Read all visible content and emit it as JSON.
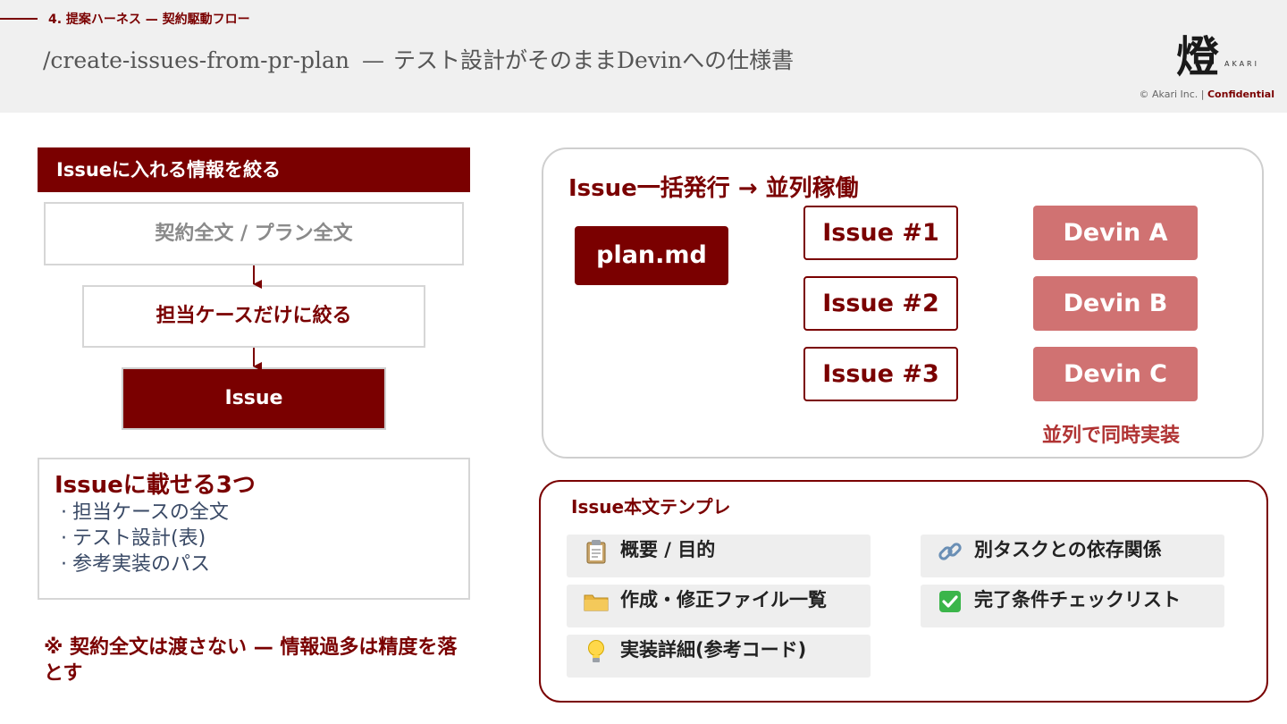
{
  "header": {
    "section_label": "4. 提案ハーネス — 契約駆動フロー",
    "title_command": "/create-issues-from-pr-plan",
    "title_separator": "—",
    "title_text": "テスト設計がそのままDevinへの仕様書",
    "logo_glyph": "燈",
    "logo_subtext": "AKARI",
    "copyright_prefix": "© Akari Inc. | ",
    "copyright_emphasis": "Confidential"
  },
  "left": {
    "section_header": "Issueに入れる情報を絞る",
    "steps": [
      "契約全文 / プラン全文",
      "担当ケースだけに絞る",
      "Issue"
    ],
    "three_title": "Issueに載せる3つ",
    "three_items": [
      "担当ケースの全文",
      "テスト設計(表)",
      "参考実装のパス"
    ],
    "bullet": "·",
    "note": "※ 契約全文は渡さない — 情報過多は精度を落とす"
  },
  "issue_panel": {
    "title": "Issue一括発行 → 並列稼働",
    "source": "plan.md",
    "issues": [
      "Issue #1",
      "Issue #2",
      "Issue #3"
    ],
    "devins": [
      "Devin A",
      "Devin B",
      "Devin C"
    ],
    "note": "並列で同時実装"
  },
  "template_panel": {
    "title": "Issue本文テンプレ",
    "items": [
      {
        "icon": "clipboard-icon",
        "label": "概要 / 目的"
      },
      {
        "icon": "folder-icon",
        "label": "作成・修正ファイル一覧"
      },
      {
        "icon": "lightbulb-icon",
        "label": "実装詳細(参考コード)"
      },
      {
        "icon": "link-icon",
        "label": "別タスクとの依存関係"
      },
      {
        "icon": "checkmark-icon",
        "label": "完了条件チェックリスト"
      }
    ]
  },
  "colors": {
    "brand": "#7a0000",
    "devin": "#d07272",
    "list_text": "#3a4a66"
  }
}
